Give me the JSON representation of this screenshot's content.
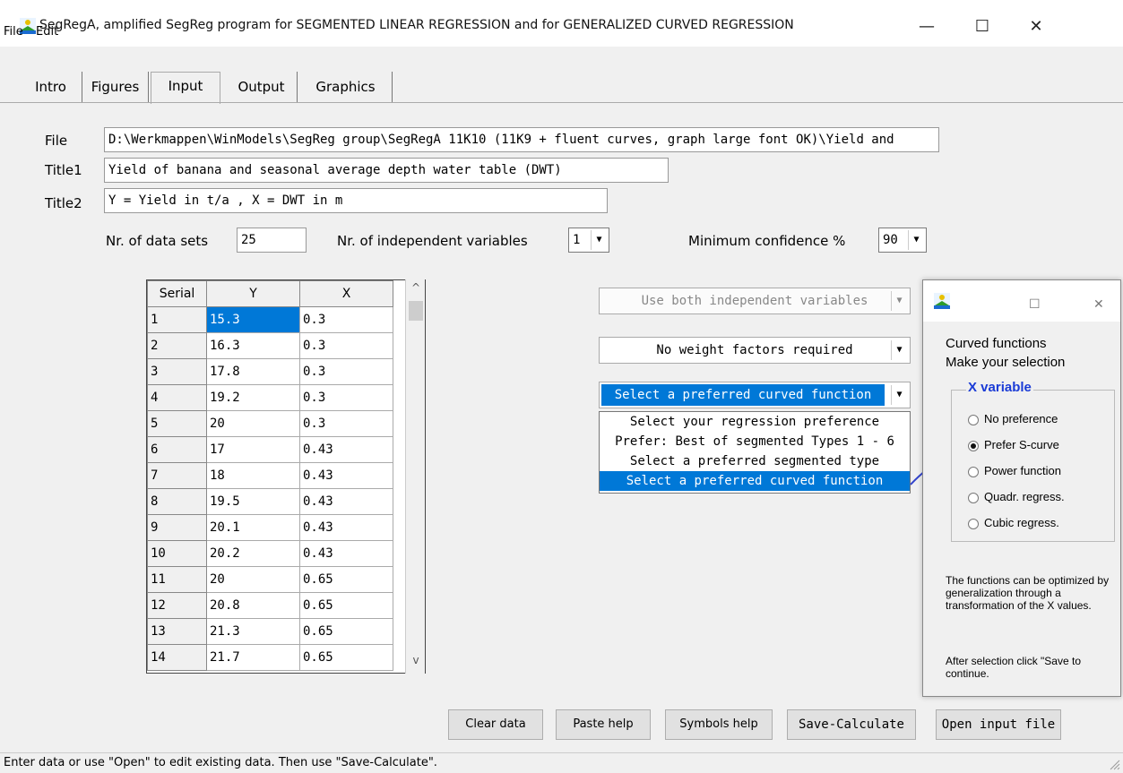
{
  "window": {
    "title": "SegRegA, amplified SegReg program for SEGMENTED LINEAR REGRESSION and  for GENERALIZED CURVED REGRESSION",
    "minimize": "—",
    "maximize": "☐",
    "close": "✕"
  },
  "menu": [
    "File",
    "Edit"
  ],
  "tabs": [
    "Intro",
    "Figures",
    "Input",
    "Output",
    "Graphics"
  ],
  "active_tab": "Input",
  "form": {
    "file_label": "File",
    "file_value": "D:\\Werkmappen\\WinModels\\SegReg group\\SegRegA 11K10  (11K9 + fluent curves, graph large font OK)\\Yield and",
    "title1_label": "Title1",
    "title1_value": "Yield of banana and seasonal average depth water table (DWT)",
    "title2_label": "Title2",
    "title2_value": "Y = Yield in t/a , X = DWT in m",
    "nr_sets_label": "Nr. of data sets",
    "nr_sets_value": "25",
    "nr_indep_label": "Nr. of independent variables",
    "nr_indep_value": "1",
    "min_conf_label": "Minimum confidence %",
    "min_conf_value": "90"
  },
  "grid": {
    "headers": [
      "Serial",
      "Y",
      "X"
    ],
    "rows": [
      [
        "1",
        "15.3",
        "0.3"
      ],
      [
        "2",
        "16.3",
        "0.3"
      ],
      [
        "3",
        "17.8",
        "0.3"
      ],
      [
        "4",
        "19.2",
        "0.3"
      ],
      [
        "5",
        "20",
        "0.3"
      ],
      [
        "6",
        "17",
        "0.43"
      ],
      [
        "7",
        "18",
        "0.43"
      ],
      [
        "8",
        "19.5",
        "0.43"
      ],
      [
        "9",
        "20.1",
        "0.43"
      ],
      [
        "10",
        "20.2",
        "0.43"
      ],
      [
        "11",
        "20",
        "0.65"
      ],
      [
        "12",
        "20.8",
        "0.65"
      ],
      [
        "13",
        "21.3",
        "0.65"
      ],
      [
        "14",
        "21.7",
        "0.65"
      ]
    ]
  },
  "options": {
    "indep_vars": "Use both independent variables",
    "weights": "No weight factors required",
    "curved_selected": "Select a preferred curved function",
    "dropdown_items": [
      "Select your regression preference",
      "Prefer: Best of segmented Types 1 - 6",
      "Select a preferred segmented type",
      "Select a preferred curved function"
    ]
  },
  "buttons": {
    "clear": "Clear data",
    "paste": "Paste help",
    "symbols": "Symbols help",
    "save_calc": "Save-Calculate",
    "open_input": "Open input file"
  },
  "status": "Enter data or use \"Open\" to edit existing data. Then use \"Save-Calculate\".",
  "popup": {
    "maximize": "☐",
    "close": "✕",
    "heading_1": "Curved functions",
    "heading_2": "Make your selection",
    "group_title": "X variable",
    "radios": [
      "No preference",
      "Prefer S-curve",
      "Power function",
      "Quadr. regress.",
      "Cubic regress."
    ],
    "selected_radio": "Prefer S-curve",
    "note_1": "The functions can be optimized by generalization through a transformation of the X values.",
    "note_2": "After selection click \"Save to continue."
  },
  "colors": {
    "selection": "#0078d7",
    "group_title": "#1a3bd6",
    "arrow": "#3344cc"
  }
}
